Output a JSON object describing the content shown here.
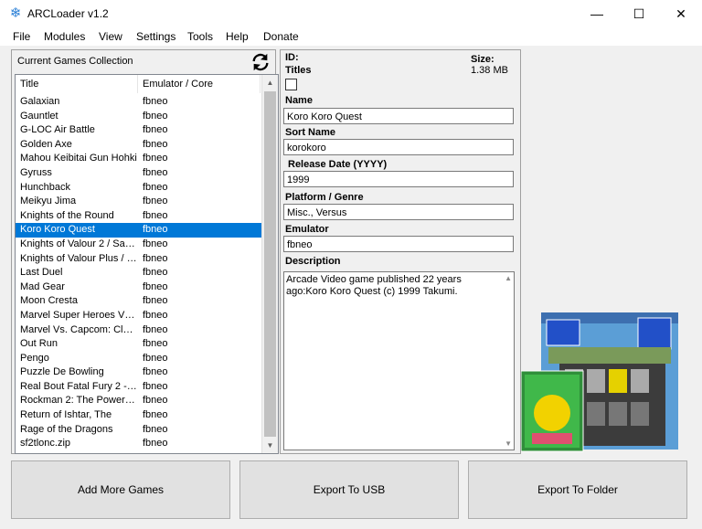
{
  "window": {
    "title": "ARCLoader v1.2",
    "minimize": "—",
    "maximize": "☐",
    "close": "✕"
  },
  "menu": [
    "File",
    "Modules",
    "View",
    "Settings",
    "Tools",
    "Help",
    "Donate"
  ],
  "collection": {
    "header": "Current Games Collection",
    "columns": [
      "Title",
      "Emulator / Core"
    ],
    "selected_index": 9,
    "rows": [
      {
        "title": "Galaxian",
        "emu": "fbneo"
      },
      {
        "title": "Gauntlet",
        "emu": "fbneo"
      },
      {
        "title": "G-LOC Air Battle",
        "emu": "fbneo"
      },
      {
        "title": "Golden Axe",
        "emu": "fbneo"
      },
      {
        "title": "Mahou Keibitai Gun Hohki",
        "emu": "fbneo"
      },
      {
        "title": "Gyruss",
        "emu": "fbneo"
      },
      {
        "title": "Hunchback",
        "emu": "fbneo"
      },
      {
        "title": "Meikyu Jima",
        "emu": "fbneo"
      },
      {
        "title": "Knights of the Round",
        "emu": "fbneo"
      },
      {
        "title": "Koro Koro Quest",
        "emu": "fbneo"
      },
      {
        "title": "Knights of Valour 2 / Sang...",
        "emu": "fbneo"
      },
      {
        "title": "Knights of Valour Plus / S...",
        "emu": "fbneo"
      },
      {
        "title": "Last Duel",
        "emu": "fbneo"
      },
      {
        "title": "Mad Gear",
        "emu": "fbneo"
      },
      {
        "title": "Moon Cresta",
        "emu": "fbneo"
      },
      {
        "title": "Marvel Super Heroes Vs. ...",
        "emu": "fbneo"
      },
      {
        "title": "Marvel Vs. Capcom: Clash...",
        "emu": "fbneo"
      },
      {
        "title": "Out Run",
        "emu": "fbneo"
      },
      {
        "title": "Pengo",
        "emu": "fbneo"
      },
      {
        "title": "Puzzle De Bowling",
        "emu": "fbneo"
      },
      {
        "title": "Real Bout Fatal Fury 2 - T...",
        "emu": "fbneo"
      },
      {
        "title": "Rockman 2: The Power Fi...",
        "emu": "fbneo"
      },
      {
        "title": "Return of Ishtar, The",
        "emu": "fbneo"
      },
      {
        "title": "Rage of the Dragons",
        "emu": "fbneo"
      },
      {
        "title": "sf2tlonc.zip",
        "emu": "fbneo"
      }
    ]
  },
  "details": {
    "id_label": "ID:",
    "titles_label": "Titles",
    "size_label": "Size:",
    "size_value": "1.38 MB",
    "name_label": "Name",
    "name_value": "Koro Koro Quest",
    "sort_label": "Sort Name",
    "sort_value": "korokoro",
    "release_label": "Release Date (YYYY)",
    "release_value": "1999",
    "platform_label": "Platform / Genre",
    "platform_value": "Misc., Versus",
    "emulator_label": "Emulator",
    "emulator_value": "fbneo",
    "description_label": "Description",
    "description_value": "Arcade Video game published 22 years ago:Koro Koro Quest (c) 1999 Takumi."
  },
  "buttons": {
    "add": "Add More Games",
    "usb": "Export To USB",
    "folder": "Export To Folder"
  },
  "colors": {
    "selection": "#0078d7",
    "panel": "#f0f0f0"
  }
}
